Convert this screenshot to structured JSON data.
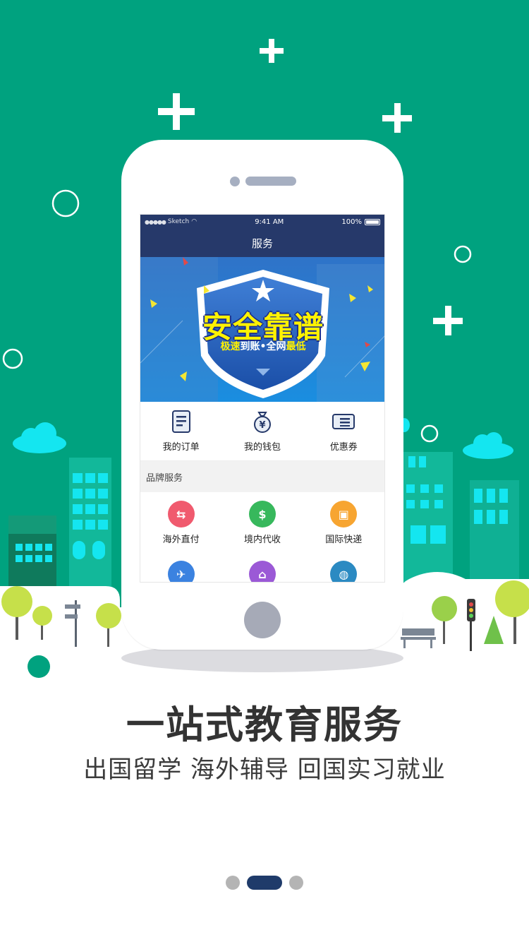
{
  "colors": {
    "background_green": "#00a27f",
    "navbar_blue": "#26396a",
    "banner_blue": "#1e7fd0",
    "headline_text": "#333333",
    "active_dot": "#1f3b6a"
  },
  "status_bar": {
    "carrier": "Sketch",
    "time": "9:41 AM",
    "battery": "100%"
  },
  "nav": {
    "title": "服务"
  },
  "banner": {
    "title": "安全靠谱",
    "subtitle_part1": "极速",
    "subtitle_part2": "到账•全网",
    "subtitle_part3": "最低"
  },
  "quick_actions": [
    {
      "label": "我的订单",
      "icon": "order-icon"
    },
    {
      "label": "我的钱包",
      "icon": "wallet-icon"
    },
    {
      "label": "优惠券",
      "icon": "coupon-icon"
    }
  ],
  "section": {
    "title": "品牌服务"
  },
  "services": [
    {
      "label": "海外直付",
      "icon": "overseas-pay-icon",
      "color": "#f05a6e"
    },
    {
      "label": "境内代收",
      "icon": "domestic-collect-icon",
      "color": "#37b85c"
    },
    {
      "label": "国际快递",
      "icon": "express-icon",
      "color": "#f7a531"
    }
  ],
  "services_row2": [
    {
      "icon": "flight-icon",
      "color": "#3b82e0"
    },
    {
      "icon": "housing-icon",
      "color": "#9b59d6"
    },
    {
      "icon": "globe-icon",
      "color": "#2b8ac2"
    }
  ],
  "headline": "一站式教育服务",
  "subline": "出国留学 海外辅导 回国实习就业",
  "pagination": {
    "total": 3,
    "active_index": 1
  }
}
